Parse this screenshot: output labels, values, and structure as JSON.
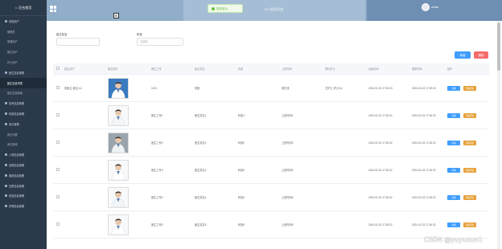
{
  "sidebar": {
    "title": "后台首页",
    "items": [
      {
        "label": "系统用户",
        "sub": false,
        "active": false
      },
      {
        "label": "管理员",
        "sub": true,
        "active": false
      },
      {
        "label": "普通用户",
        "sub": true,
        "active": false
      },
      {
        "label": "医生用户",
        "sub": true,
        "active": false
      },
      {
        "label": "护士用户",
        "sub": true,
        "active": false
      },
      {
        "label": "医生信息管理",
        "sub": false,
        "active": false
      },
      {
        "label": "医生信息列表",
        "sub": true,
        "active": true
      },
      {
        "label": "医生信息新增",
        "sub": true,
        "active": false
      },
      {
        "label": "挂号信息管理",
        "sub": false,
        "active": false
      },
      {
        "label": "科室信息管理",
        "sub": false,
        "active": false
      },
      {
        "label": "床位管理",
        "sub": false,
        "active": false
      },
      {
        "label": "床位列表",
        "sub": true,
        "active": false
      },
      {
        "label": "床位新增",
        "sub": true,
        "active": false
      },
      {
        "label": "入院信息管理",
        "sub": false,
        "active": false
      },
      {
        "label": "出院信息管理",
        "sub": false,
        "active": false
      },
      {
        "label": "缴费信息管理",
        "sub": false,
        "active": false
      },
      {
        "label": "住院信息管理",
        "sub": false,
        "active": false
      },
      {
        "label": "药品信息管理",
        "sub": false,
        "active": false
      },
      {
        "label": "护理信息管理",
        "sub": false,
        "active": false
      }
    ]
  },
  "header": {
    "title": "XXX管理系统",
    "username": "admin"
  },
  "toast": {
    "message": "登录成功"
  },
  "search": {
    "name_label": "医生姓名",
    "name_placeholder": "",
    "dept_label": "科室",
    "dept_placeholder": "请选择",
    "add_label": "新增",
    "delete_label": "删除"
  },
  "table": {
    "headers": [
      "医生用户",
      "医生照片",
      "医生工号",
      "医生姓名",
      "科室",
      "上班时间",
      "预约护士",
      "创建时间",
      "更新时间",
      "操作"
    ],
    "edit_label": "详情",
    "view_label": "查看评论",
    "rows": [
      {
        "user": "张医生-医生111",
        "id": "1001",
        "name": "张医",
        "dept": "",
        "time": "周日班",
        "nurse": "王护士-护士111",
        "created": "2024-02-23 17:39:03",
        "updated": "2024-02-23 17:39:03"
      },
      {
        "user": "",
        "id": "医生工号1",
        "name": "医生姓名1",
        "dept": "科室1",
        "time": "上班时间1",
        "nurse": "",
        "created": "2024-02-23 17:26:32",
        "updated": "2024-02-23 17:26:32"
      },
      {
        "user": "",
        "id": "医生工号2",
        "name": "医生姓名2",
        "dept": "科室2",
        "time": "上班时间2",
        "nurse": "",
        "created": "2024-02-23 17:26:32",
        "updated": "2024-02-23 17:26:32"
      },
      {
        "user": "",
        "id": "医生工号3",
        "name": "医生姓名3",
        "dept": "科室3",
        "time": "上班时间3",
        "nurse": "",
        "created": "2024-02-23 17:26:32",
        "updated": "2024-02-23 17:26:32"
      },
      {
        "user": "",
        "id": "医生工号4",
        "name": "医生姓名4",
        "dept": "科室4",
        "time": "上班时间4",
        "nurse": "",
        "created": "2024-02-23 17:26:32",
        "updated": "2024-02-23 17:26:32"
      },
      {
        "user": "",
        "id": "医生工号5",
        "name": "医生姓名5",
        "dept": "科室5",
        "time": "上班时间5",
        "nurse": "",
        "created": "2024-02-23 17:26:32",
        "updated": "2024-02-23 17:26:32"
      }
    ]
  },
  "watermark": "CSDN @yuyuxun1",
  "colors": {
    "sidebar_bg": "#2b3a4b",
    "header_bg": "#90adc9",
    "primary": "#409eff",
    "danger": "#f56c6c",
    "warning": "#e6a23c",
    "success": "#67c23a"
  }
}
